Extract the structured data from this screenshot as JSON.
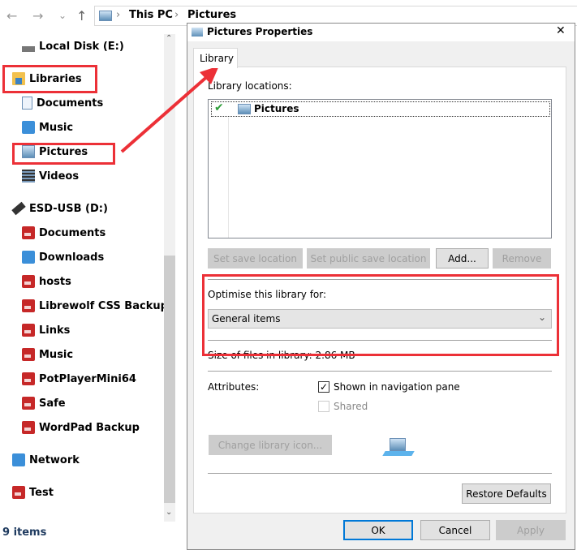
{
  "explorer": {
    "nav": {
      "back": "←",
      "forward": "→",
      "recent": "⌄",
      "up": "↑"
    },
    "breadcrumb": [
      "This PC",
      "Pictures"
    ],
    "tree": [
      {
        "label": "Local Disk (E:)",
        "icon": "disk-icon",
        "level": 1
      },
      {
        "label": "Libraries",
        "icon": "libraries-icon",
        "level": 0
      },
      {
        "label": "Documents",
        "icon": "documents-icon",
        "level": 1
      },
      {
        "label": "Music",
        "icon": "music-icon",
        "level": 1
      },
      {
        "label": "Pictures",
        "icon": "pictures-icon",
        "level": 1
      },
      {
        "label": "Videos",
        "icon": "videos-icon",
        "level": 1
      },
      {
        "label": "ESD-USB (D:)",
        "icon": "usb-drive-icon",
        "level": 0
      },
      {
        "label": "Documents",
        "icon": "folder-icon",
        "level": 1
      },
      {
        "label": "Downloads",
        "icon": "downloads-icon",
        "level": 1
      },
      {
        "label": "hosts",
        "icon": "folder-icon",
        "level": 1
      },
      {
        "label": "Librewolf CSS Backup",
        "icon": "folder-icon",
        "level": 1
      },
      {
        "label": "Links",
        "icon": "folder-icon",
        "level": 1
      },
      {
        "label": "Music",
        "icon": "folder-icon",
        "level": 1
      },
      {
        "label": "PotPlayerMini64",
        "icon": "folder-icon",
        "level": 1
      },
      {
        "label": "Safe",
        "icon": "folder-icon",
        "level": 1
      },
      {
        "label": "WordPad Backup",
        "icon": "folder-icon",
        "level": 1
      },
      {
        "label": "Network",
        "icon": "network-icon",
        "level": 0
      },
      {
        "label": "Test",
        "icon": "folder-icon",
        "level": 0
      }
    ],
    "status": "9 items"
  },
  "dialog": {
    "title": "Pictures Properties",
    "close": "✕",
    "tab": "Library",
    "locations_label": "Library locations:",
    "locations": [
      {
        "name": "Pictures",
        "checked": true
      }
    ],
    "buttons": {
      "set_save": "Set save location",
      "set_public": "Set public save location",
      "add": "Add...",
      "remove": "Remove"
    },
    "optimise_label": "Optimise this library for:",
    "optimise_value": "General items",
    "size_text": "Size of files in library:   2.86 MB",
    "attributes_label": "Attributes:",
    "shown_in_nav": {
      "label": "Shown in navigation pane",
      "checked": true
    },
    "shared": {
      "label": "Shared",
      "checked": false,
      "disabled": true
    },
    "change_icon": "Change library icon...",
    "restore": "Restore Defaults",
    "ok": "OK",
    "cancel": "Cancel",
    "apply": "Apply"
  },
  "colors": {
    "annotation": "#ec3037",
    "accent": "#0078d7"
  }
}
